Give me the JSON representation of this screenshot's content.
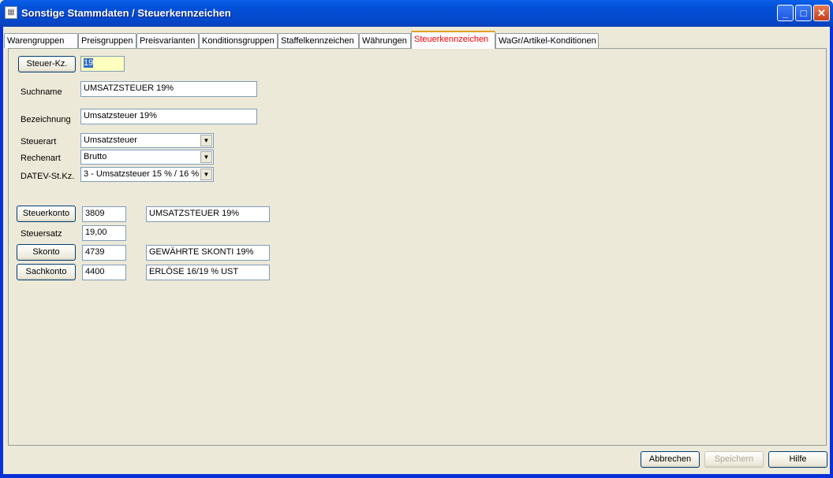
{
  "window": {
    "title": "Sonstige Stammdaten / Steuerkennzeichen",
    "minimize": "_",
    "maximize": "□",
    "close": "✕"
  },
  "tabs": [
    {
      "label": "Warengruppen"
    },
    {
      "label": "Preisgruppen"
    },
    {
      "label": "Preisvarianten"
    },
    {
      "label": "Konditionsgruppen"
    },
    {
      "label": "Staffelkennzeichen"
    },
    {
      "label": "Währungen"
    },
    {
      "label": "Steuerkennzeichen",
      "active": true
    },
    {
      "label": "WaGr/Artikel-Konditionen"
    }
  ],
  "form": {
    "steuer_kz_button": "Steuer-Kz.",
    "steuer_kz_value": "19",
    "suchname_label": "Suchname",
    "suchname_value": "UMSATZSTEUER 19%",
    "bezeichnung_label": "Bezeichnung",
    "bezeichnung_value": "Umsatzsteuer 19%",
    "steuerart_label": "Steuerart",
    "steuerart_value": "Umsatzsteuer",
    "rechenart_label": "Rechenart",
    "rechenart_value": "Brutto",
    "datev_label": "DATEV-St.Kz.",
    "datev_value": "3 - Umsatzsteuer 15 % / 16 %",
    "steuerkonto_button": "Steuerkonto",
    "steuerkonto_value": "3809",
    "steuerkonto_desc": "UMSATZSTEUER 19%",
    "steuersatz_label": "Steuersatz",
    "steuersatz_value": "19,00",
    "skonto_button": "Skonto",
    "skonto_value": "4739",
    "skonto_desc": "GEWÄHRTE SKONTI 19%",
    "sachkonto_button": "Sachkonto",
    "sachkonto_value": "4400",
    "sachkonto_desc": "ERLÖSE 16/19 % UST"
  },
  "footer": {
    "cancel": "Abbrechen",
    "save": "Speichern",
    "help": "Hilfe"
  }
}
